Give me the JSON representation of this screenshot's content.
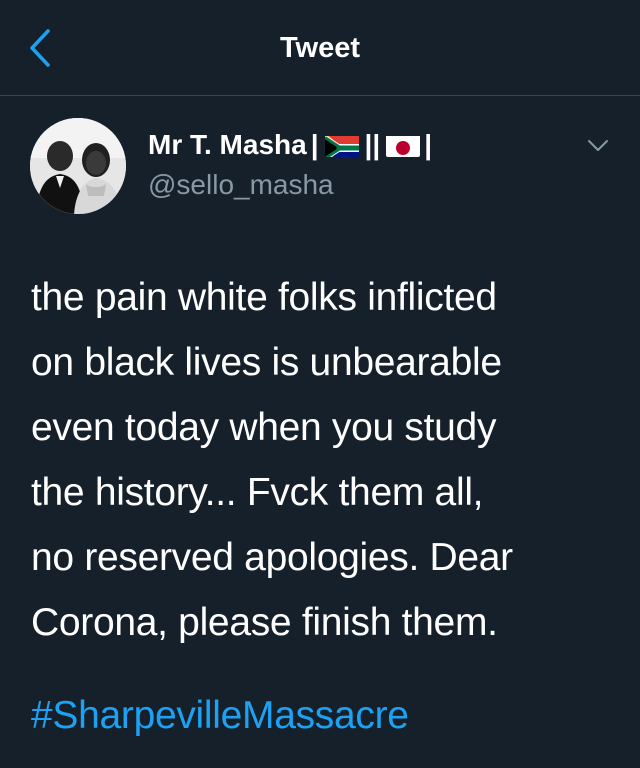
{
  "nav": {
    "title": "Tweet"
  },
  "author": {
    "display_name": "Mr T. Masha",
    "name_separator_1": "|",
    "name_separator_2": "||",
    "name_separator_3": "|",
    "flags": [
      "south-africa-flag",
      "japan-flag"
    ],
    "handle": "@sello_masha"
  },
  "tweet": {
    "lines": [
      "the pain white folks inflicted",
      "on black lives is unbearable",
      "even today when you study",
      "the history... Fvck them all,",
      "no reserved apologies. Dear",
      "Corona, please finish them."
    ],
    "hashtag": "#SharpevilleMassacre"
  },
  "icons": {
    "back": "chevron-left-icon",
    "more": "chevron-down-icon"
  },
  "colors": {
    "background": "#15202b",
    "accent": "#1da1f2",
    "secondary_text": "#8899a6",
    "divider": "#38444d"
  }
}
